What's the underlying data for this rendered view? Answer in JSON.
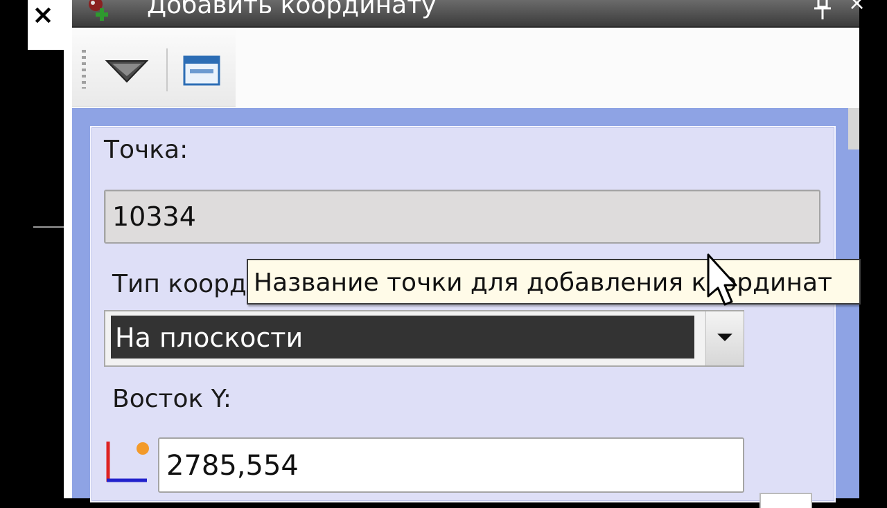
{
  "app": {
    "close_glyph": "×",
    "accent_bg": "#8ea3e4",
    "group_bg": "#dedff7"
  },
  "titlebar": {
    "title": "Добавить координату",
    "pin_icon": "pin-icon",
    "close_glyph": "×"
  },
  "toolbar": {
    "dropdown_icon": "triangle-down-icon",
    "window_icon": "window-icon"
  },
  "form": {
    "point_label": "Точка:",
    "point_value": "10334",
    "coord_type_label": "Тип координат:",
    "coord_type_value": "На плоскости",
    "east_label": "Восток Y:",
    "east_value": "2785,554"
  },
  "tooltip": {
    "text": "Название точки для добавления координат"
  }
}
